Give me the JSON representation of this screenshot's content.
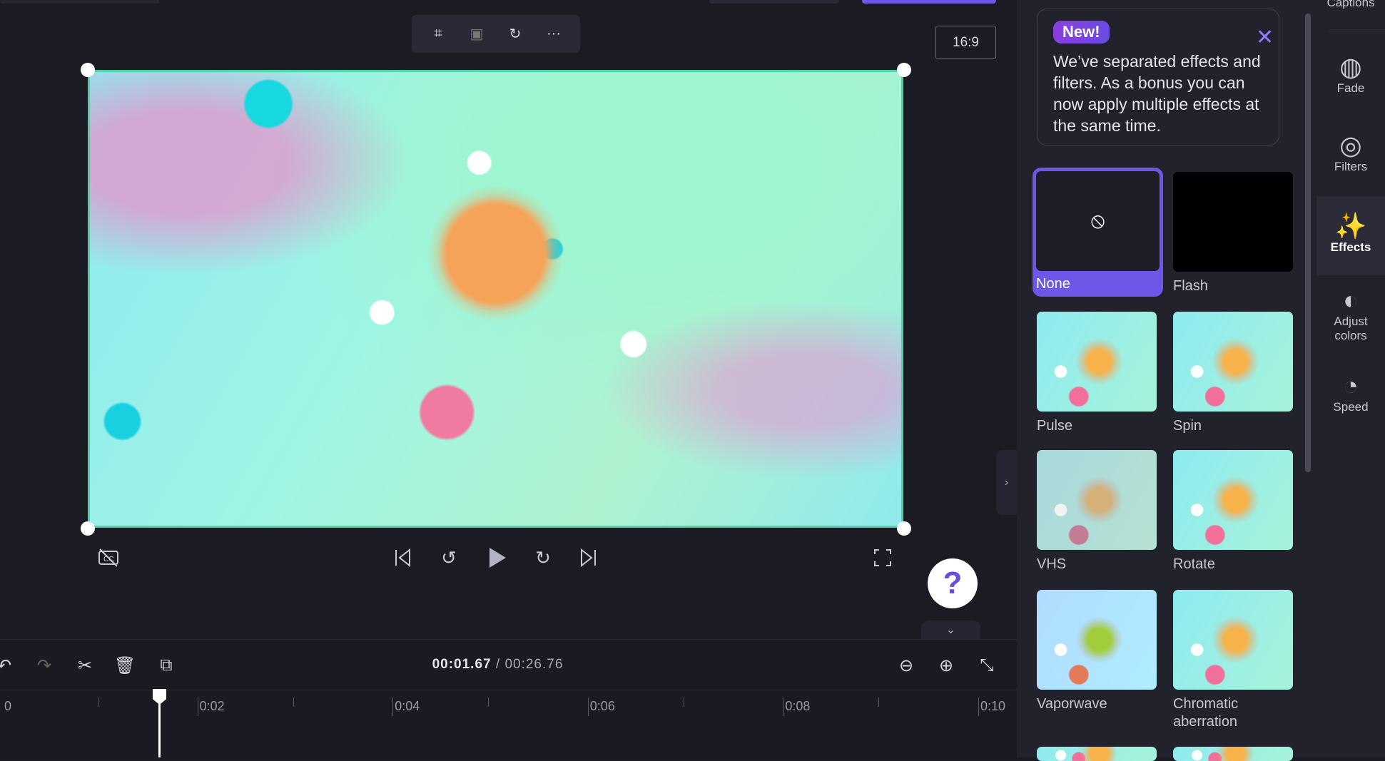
{
  "preview": {
    "aspect_ratio": "16:9",
    "toolbar_icons": [
      "crop-icon",
      "fit-icon",
      "rotate-icon",
      "more-icon"
    ]
  },
  "playback": {
    "current_time": "00:01.67",
    "separator": " / ",
    "total_time": "00:26.76",
    "help": "?"
  },
  "timeline": {
    "ticks": [
      "0",
      "0:02",
      "0:04",
      "0:06",
      "0:08",
      "0:10"
    ]
  },
  "panel": {
    "notice": {
      "badge": "New!",
      "text": "We’ve separated effects and filters. As a bonus you can now apply multiple effects at the same time."
    },
    "effects": [
      {
        "label": "None",
        "selected": true
      },
      {
        "label": "Flash"
      },
      {
        "label": "Pulse"
      },
      {
        "label": "Spin"
      },
      {
        "label": "VHS"
      },
      {
        "label": "Rotate"
      },
      {
        "label": "Vaporwave"
      },
      {
        "label": "Chromatic aberration"
      }
    ]
  },
  "sidenav": {
    "items": [
      {
        "label": "Captions"
      },
      {
        "label": "Fade"
      },
      {
        "label": "Filters"
      },
      {
        "label": "Effects",
        "active": true
      },
      {
        "label": "Adjust colors"
      },
      {
        "label": "Speed"
      }
    ]
  },
  "colors": {
    "accent": "#6d57e6",
    "video_border": "#4fd1a5"
  }
}
